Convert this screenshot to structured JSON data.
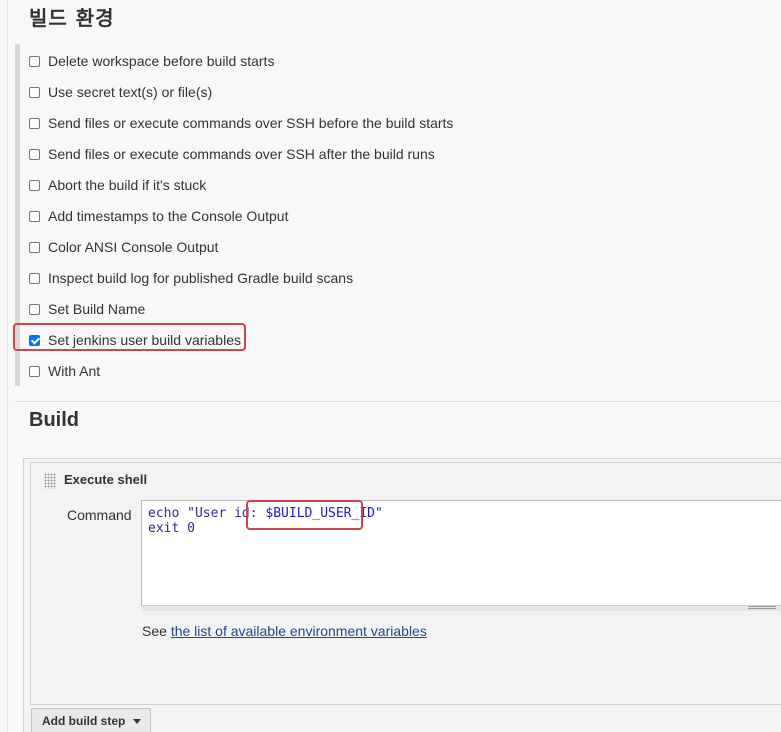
{
  "build_environment": {
    "title": "빌드 환경",
    "options": [
      {
        "label": "Delete workspace before build starts",
        "checked": false
      },
      {
        "label": "Use secret text(s) or file(s)",
        "checked": false
      },
      {
        "label": "Send files or execute commands over SSH before the build starts",
        "checked": false
      },
      {
        "label": "Send files or execute commands over SSH after the build runs",
        "checked": false
      },
      {
        "label": "Abort the build if it's stuck",
        "checked": false
      },
      {
        "label": "Add timestamps to the Console Output",
        "checked": false
      },
      {
        "label": "Color ANSI Console Output",
        "checked": false
      },
      {
        "label": "Inspect build log for published Gradle build scans",
        "checked": false
      },
      {
        "label": "Set Build Name",
        "checked": false
      },
      {
        "label": "Set jenkins user build variables",
        "checked": true
      },
      {
        "label": "With Ant",
        "checked": false
      }
    ]
  },
  "build": {
    "title": "Build",
    "step": {
      "title": "Execute shell",
      "command_label": "Command",
      "command_line1_prefix": "echo \"User id:",
      "command_line1_var": "$BUILD_USER_ID\"",
      "command_line2": "exit 0",
      "see_text": "See ",
      "see_link": "the list of available environment variables"
    },
    "add_step_label": "Add build step"
  },
  "colors": {
    "highlight": "#c9474f",
    "checkbox_checked": "#0075ff",
    "link": "#204a87"
  }
}
